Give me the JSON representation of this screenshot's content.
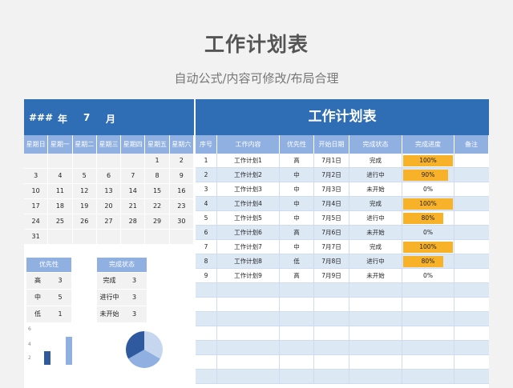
{
  "header": {
    "title": "工作计划表",
    "subtitle": "自动公式/内容可修改/布局合理"
  },
  "calendar": {
    "year": "###",
    "year_label": "年",
    "month": "7",
    "month_label": "月",
    "weekdays": [
      "星期日",
      "星期一",
      "星期二",
      "星期三",
      "星期四",
      "星期五",
      "星期六"
    ],
    "rows": [
      [
        "",
        "",
        "",
        "",
        "",
        "1",
        "2"
      ],
      [
        "3",
        "4",
        "5",
        "6",
        "7",
        "8",
        "9"
      ],
      [
        "10",
        "11",
        "12",
        "13",
        "14",
        "15",
        "16"
      ],
      [
        "17",
        "18",
        "19",
        "20",
        "21",
        "22",
        "23"
      ],
      [
        "24",
        "25",
        "26",
        "27",
        "28",
        "29",
        "30"
      ],
      [
        "31",
        "",
        "",
        "",
        "",
        "",
        ""
      ]
    ]
  },
  "priority_summary": {
    "header": "优先性",
    "rows": [
      [
        "高",
        "3"
      ],
      [
        "中",
        "5"
      ],
      [
        "低",
        "1"
      ]
    ]
  },
  "status_summary": {
    "header": "完成状态",
    "rows": [
      [
        "完成",
        "3"
      ],
      [
        "进行中",
        "3"
      ],
      [
        "未开始",
        "3"
      ]
    ]
  },
  "chart_ticks": [
    "6",
    "4",
    "2"
  ],
  "table": {
    "title": "工作计划表",
    "columns": [
      "序号",
      "工作内容",
      "优先性",
      "开始日期",
      "完成状态",
      "完成进度",
      "备注"
    ],
    "rows": [
      {
        "no": "1",
        "task": "工作计划1",
        "priority": "高",
        "date": "7月1日",
        "status": "完成",
        "progress": "100%",
        "pct": 100
      },
      {
        "no": "2",
        "task": "工作计划2",
        "priority": "中",
        "date": "7月2日",
        "status": "进行中",
        "progress": "90%",
        "pct": 90
      },
      {
        "no": "3",
        "task": "工作计划3",
        "priority": "中",
        "date": "7月3日",
        "status": "未开始",
        "progress": "0%",
        "pct": 0
      },
      {
        "no": "4",
        "task": "工作计划4",
        "priority": "中",
        "date": "7月4日",
        "status": "完成",
        "progress": "100%",
        "pct": 100
      },
      {
        "no": "5",
        "task": "工作计划5",
        "priority": "中",
        "date": "7月5日",
        "status": "进行中",
        "progress": "80%",
        "pct": 80
      },
      {
        "no": "6",
        "task": "工作计划6",
        "priority": "高",
        "date": "7月6日",
        "status": "未开始",
        "progress": "0%",
        "pct": 0
      },
      {
        "no": "7",
        "task": "工作计划7",
        "priority": "中",
        "date": "7月7日",
        "status": "完成",
        "progress": "100%",
        "pct": 100
      },
      {
        "no": "8",
        "task": "工作计划8",
        "priority": "低",
        "date": "7月8日",
        "status": "进行中",
        "progress": "80%",
        "pct": 80
      },
      {
        "no": "9",
        "task": "工作计划9",
        "priority": "高",
        "date": "7月9日",
        "status": "未开始",
        "progress": "0%",
        "pct": 0
      }
    ]
  },
  "colors": {
    "header_blue": "#2f6db5",
    "sub_header": "#8fb0e0",
    "progress": "#f8b22a",
    "row_alt": "#dde8f5"
  }
}
